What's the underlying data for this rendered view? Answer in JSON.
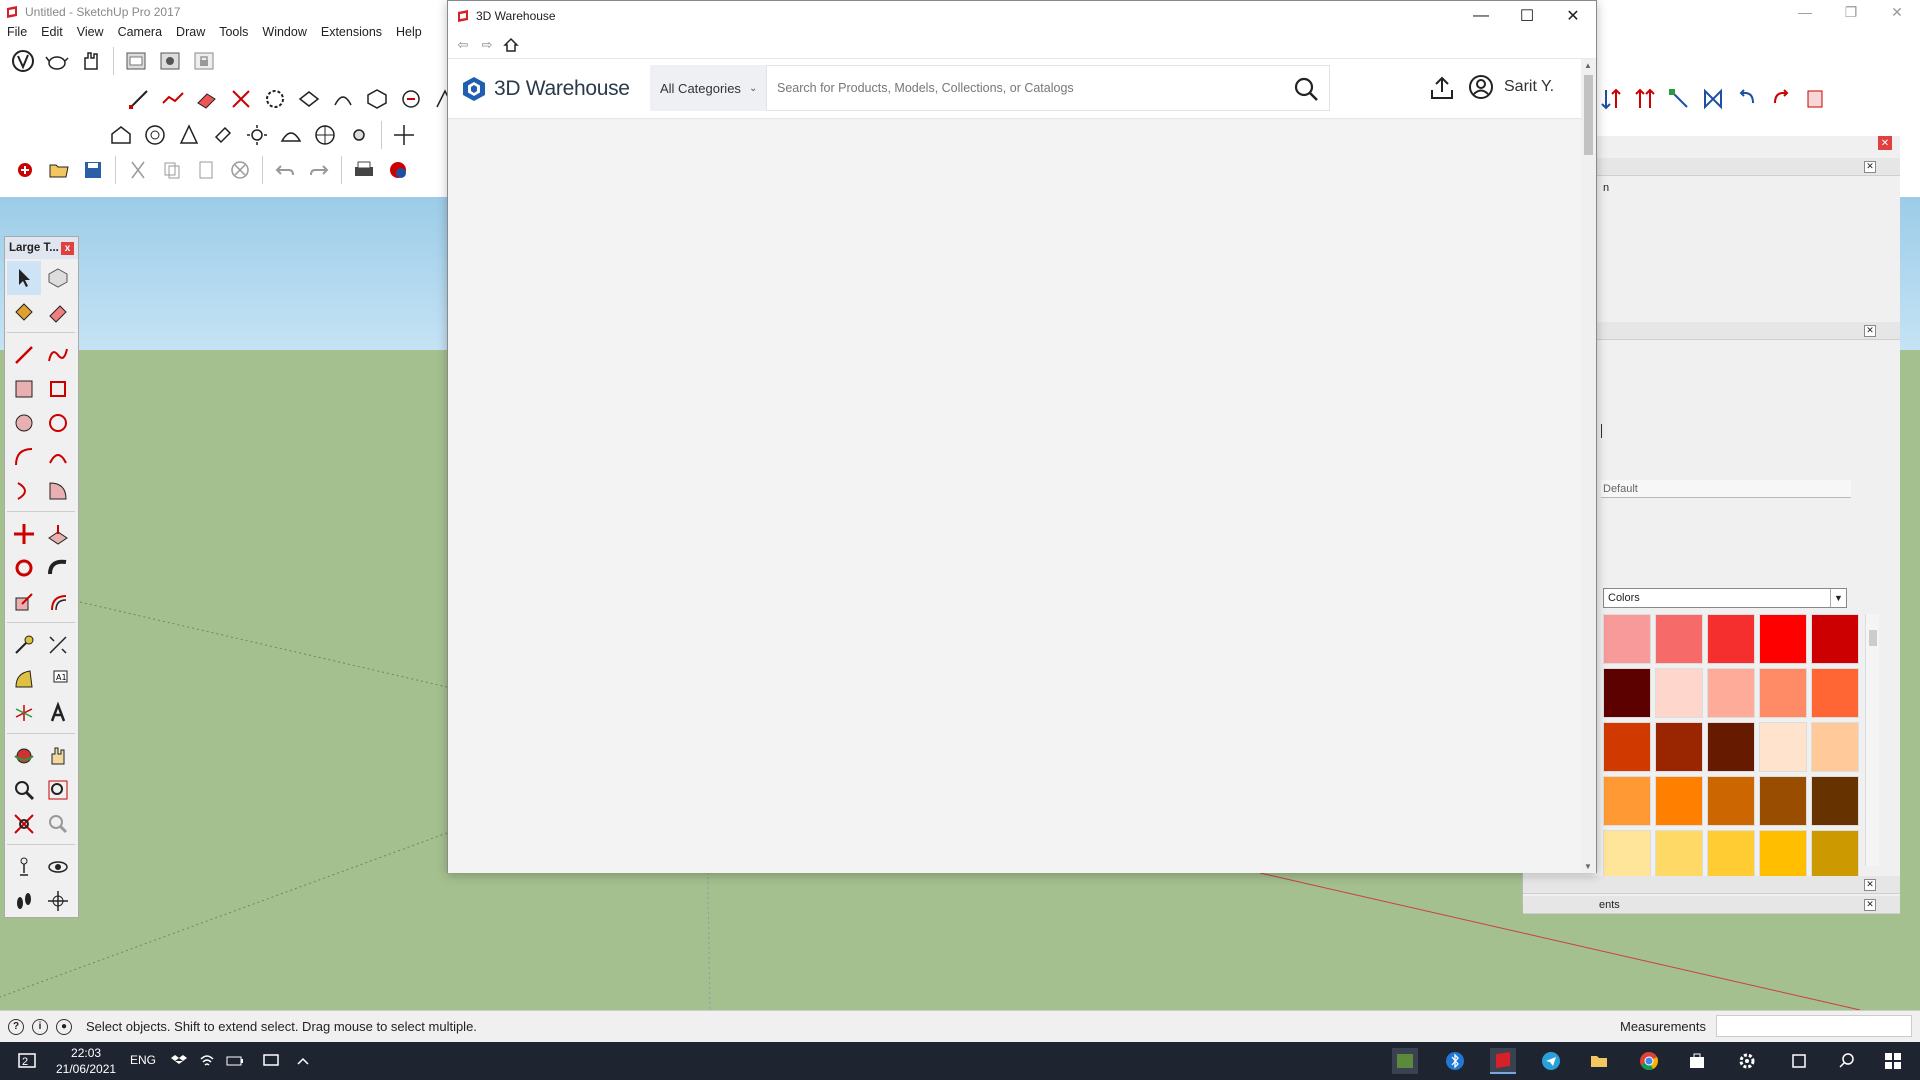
{
  "app": {
    "title": "Untitled - SketchUp Pro 2017",
    "menu": [
      "File",
      "Edit",
      "View",
      "Camera",
      "Draw",
      "Tools",
      "Window",
      "Extensions",
      "Help"
    ]
  },
  "large_tools": {
    "title": "Large T...",
    "close": "x"
  },
  "tray": {
    "default_label": "Default",
    "colors_select": "Colors",
    "row_fragment_1": "n",
    "row_fragment_2": "ents",
    "swatch_colors": [
      "#f99a9a",
      "#f76a6a",
      "#f52e2e",
      "#ff0000",
      "#cc0000",
      "#5c0000",
      "#ffd6cc",
      "#ffab99",
      "#ff8a66",
      "#ff6633",
      "#d03a00",
      "#992600",
      "#661a00",
      "#ffe3cc",
      "#ffc999",
      "#ff9933",
      "#ff8000",
      "#cc6600",
      "#994d00",
      "#663300",
      "#ffe599",
      "#ffd966",
      "#ffcc33",
      "#ffbf00",
      "#cc9900"
    ]
  },
  "status": {
    "message": "Select objects. Shift to extend select. Drag mouse to select multiple.",
    "measurements_label": "Measurements"
  },
  "taskbar": {
    "time": "22:03",
    "date": "21/06/2021",
    "lang": "ENG",
    "notification_count": "2"
  },
  "warehouse": {
    "window_title": "3D Warehouse",
    "brand": "3D Warehouse",
    "category": "All Categories",
    "search_placeholder": "Search for Products, Models, Collections, or Catalogs",
    "username": "Sarit Y."
  }
}
